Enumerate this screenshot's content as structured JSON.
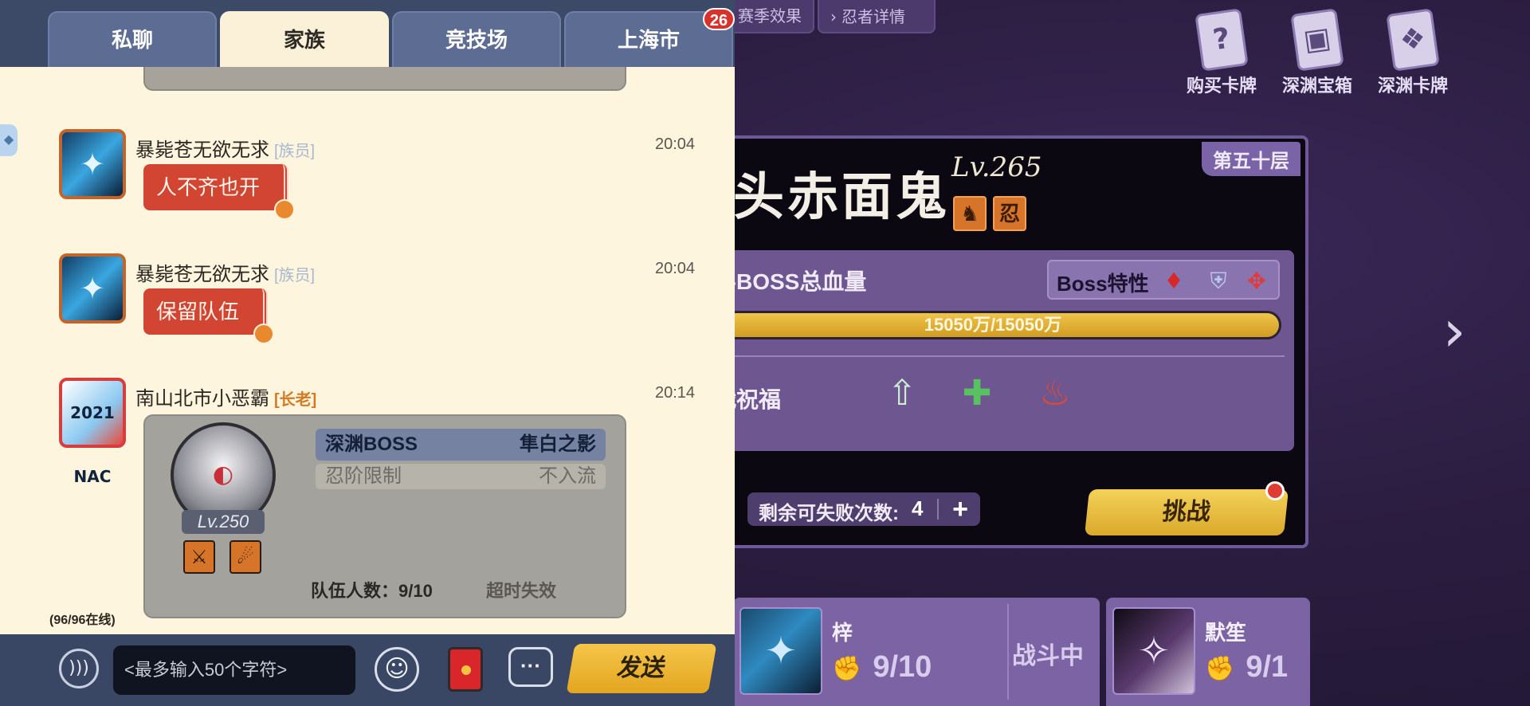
{
  "scene": {
    "top_tags": [
      "赛季效果",
      "忍者详情"
    ],
    "shop": [
      {
        "icon": "buy-card-icon",
        "label": "购买卡牌"
      },
      {
        "icon": "abyss-chest-icon",
        "label": "深渊宝箱"
      },
      {
        "icon": "abyss-card-icon",
        "label": "深渊卡牌"
      }
    ],
    "boss": {
      "floor": "第五十层",
      "name": "头赤面鬼",
      "level": "Lv.265",
      "hp_label": "层BOSS总血量",
      "traits_label": "Boss特性",
      "hp_text": "15050万/15050万",
      "hp_fraction": 1.0,
      "blessing_label": "战祝福",
      "fails_label": "剩余可失败次数:",
      "fails_count": "4",
      "challenge_label": "挑战"
    },
    "teams": [
      {
        "name": "梓",
        "count": "9/10",
        "status": "战斗中"
      },
      {
        "name": "默笙",
        "count": "9/1"
      }
    ]
  },
  "chat": {
    "tabs": [
      "私聊",
      "家族",
      "竞技场",
      "上海市"
    ],
    "active_tab": "家族",
    "badge": "26",
    "messages": [
      {
        "sender": "暴毙苍无欲无求",
        "rank": "[族员]",
        "time": "20:04",
        "text": "人不齐也开"
      },
      {
        "sender": "暴毙苍无欲无求",
        "rank": "[族员]",
        "time": "20:04",
        "text": "保留队伍"
      },
      {
        "sender": "南山北市小恶霸",
        "rank": "[长老]",
        "time": "20:14",
        "avatar_text": "2021 NAC"
      }
    ],
    "invite": {
      "level": "Lv.250",
      "boss_key": "深渊BOSS",
      "boss_val": "隼白之影",
      "limit_key": "忍阶限制",
      "limit_val": "不入流",
      "team_size": "队伍人数：9/10",
      "expire": "超时失效"
    },
    "online": "(96/96在线)",
    "input_placeholder": "<最多输入50个字符>",
    "send_label": "发送"
  }
}
